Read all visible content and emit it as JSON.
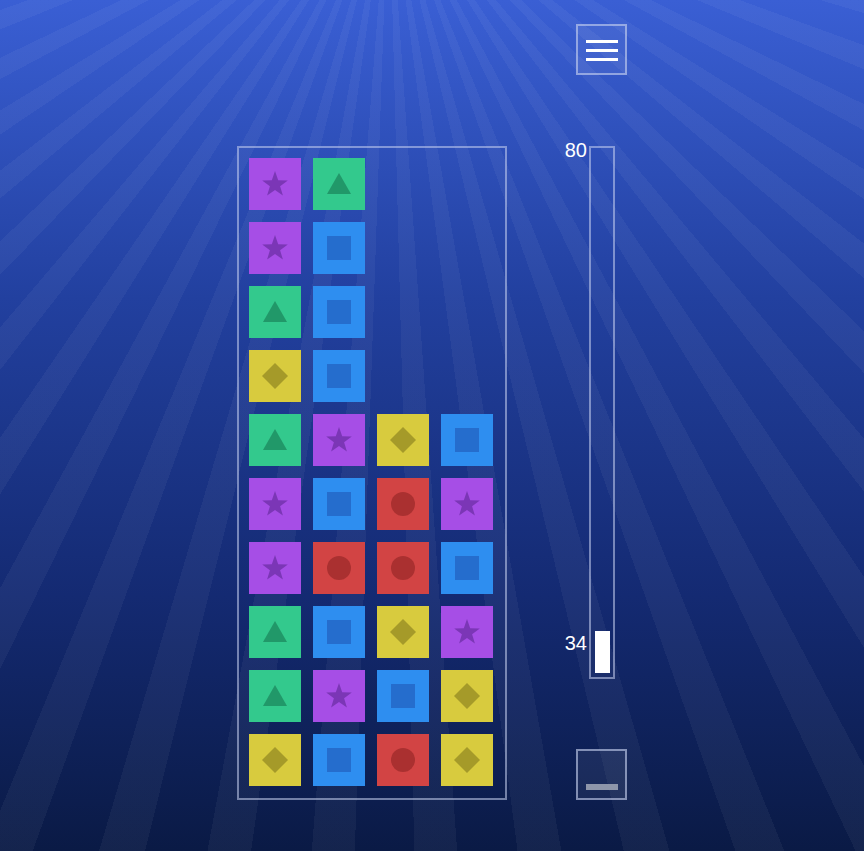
{
  "board": {
    "rows": [
      [
        {
          "kind": "star",
          "color": "#a64ee6"
        },
        {
          "kind": "triangle",
          "color": "#33c98d"
        },
        {
          "kind": "empty"
        },
        {
          "kind": "empty"
        }
      ],
      [
        {
          "kind": "star",
          "color": "#a64ee6"
        },
        {
          "kind": "square",
          "color": "#2e8ef0"
        },
        {
          "kind": "empty"
        },
        {
          "kind": "empty"
        }
      ],
      [
        {
          "kind": "triangle",
          "color": "#33c98d"
        },
        {
          "kind": "square",
          "color": "#2e8ef0"
        },
        {
          "kind": "empty"
        },
        {
          "kind": "empty"
        }
      ],
      [
        {
          "kind": "diamond",
          "color": "#d8cb3e"
        },
        {
          "kind": "square",
          "color": "#2e8ef0"
        },
        {
          "kind": "empty"
        },
        {
          "kind": "empty"
        }
      ],
      [
        {
          "kind": "triangle",
          "color": "#33c98d"
        },
        {
          "kind": "star",
          "color": "#a64ee6"
        },
        {
          "kind": "diamond",
          "color": "#d8cb3e"
        },
        {
          "kind": "square",
          "color": "#2e8ef0"
        }
      ],
      [
        {
          "kind": "star",
          "color": "#a64ee6"
        },
        {
          "kind": "square",
          "color": "#2e8ef0"
        },
        {
          "kind": "circle",
          "color": "#d24444"
        },
        {
          "kind": "star",
          "color": "#a64ee6"
        }
      ],
      [
        {
          "kind": "star",
          "color": "#a64ee6"
        },
        {
          "kind": "circle",
          "color": "#d24444"
        },
        {
          "kind": "circle",
          "color": "#d24444"
        },
        {
          "kind": "square",
          "color": "#2e8ef0"
        }
      ],
      [
        {
          "kind": "triangle",
          "color": "#33c98d"
        },
        {
          "kind": "square",
          "color": "#2e8ef0"
        },
        {
          "kind": "diamond",
          "color": "#d8cb3e"
        },
        {
          "kind": "star",
          "color": "#a64ee6"
        }
      ],
      [
        {
          "kind": "triangle",
          "color": "#33c98d"
        },
        {
          "kind": "star",
          "color": "#a64ee6"
        },
        {
          "kind": "square",
          "color": "#2e8ef0"
        },
        {
          "kind": "diamond",
          "color": "#d8cb3e"
        }
      ],
      [
        {
          "kind": "diamond",
          "color": "#d8cb3e"
        },
        {
          "kind": "square",
          "color": "#2e8ef0"
        },
        {
          "kind": "circle",
          "color": "#d24444"
        },
        {
          "kind": "diamond",
          "color": "#d8cb3e"
        }
      ]
    ]
  },
  "meter": {
    "max_label": "80",
    "value_label": "34",
    "level": 0.08
  }
}
